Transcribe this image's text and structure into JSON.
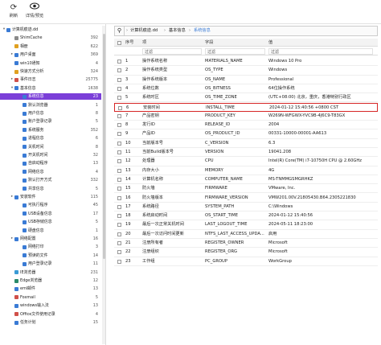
{
  "toolbar": {
    "refresh_label": "刷新",
    "view_label": "详情/预览"
  },
  "tree": [
    {
      "label": "计算机痕迹.dd",
      "count": "",
      "depth": 0,
      "expander": "▾",
      "color": "#3a7bd5"
    },
    {
      "label": "ShimCache",
      "count": "392",
      "depth": 1,
      "expander": "",
      "color": "#8a8a8a"
    },
    {
      "label": "相册",
      "count": "622",
      "depth": 1,
      "expander": "",
      "color": "#e0a020"
    },
    {
      "label": "用户桌面",
      "count": "369",
      "depth": 1,
      "expander": "▸",
      "color": "#3a7bd5"
    },
    {
      "label": "win10通知",
      "count": "4",
      "depth": 1,
      "expander": "",
      "color": "#3a7bd5"
    },
    {
      "label": "快速方式分析",
      "count": "324",
      "depth": 1,
      "expander": "",
      "color": "#e0a020"
    },
    {
      "label": "事件日志",
      "count": "25775",
      "depth": 1,
      "expander": "▸",
      "color": "#d0504a"
    },
    {
      "label": "基本信息",
      "count": "1638",
      "depth": 1,
      "expander": "▾",
      "color": "#3a7bd5"
    },
    {
      "label": "系统信息",
      "count": "23",
      "depth": 2,
      "expander": "",
      "color": "#3a7bd5",
      "selected": true
    },
    {
      "label": "默认浏览器",
      "count": "1",
      "depth": 2,
      "expander": "",
      "color": "#3a7bd5"
    },
    {
      "label": "用户信息",
      "count": "8",
      "depth": 2,
      "expander": "",
      "color": "#3a7bd5"
    },
    {
      "label": "账户登录记录",
      "count": "5",
      "depth": 2,
      "expander": "",
      "color": "#3a7bd5"
    },
    {
      "label": "系统服务",
      "count": "352",
      "depth": 2,
      "expander": "",
      "color": "#3a7bd5"
    },
    {
      "label": "进程信息",
      "count": "6",
      "depth": 2,
      "expander": "",
      "color": "#3a7bd5"
    },
    {
      "label": "关机时间",
      "count": "8",
      "depth": 2,
      "expander": "",
      "color": "#3a7bd5"
    },
    {
      "label": "开关机时间",
      "count": "32",
      "depth": 2,
      "expander": "",
      "color": "#3a7bd5"
    },
    {
      "label": "自启动程序",
      "count": "13",
      "depth": 2,
      "expander": "",
      "color": "#3a7bd5"
    },
    {
      "label": "网络信息",
      "count": "4",
      "depth": 2,
      "expander": "",
      "color": "#3a7bd5"
    },
    {
      "label": "默认打开方式",
      "count": "332",
      "depth": 2,
      "expander": "",
      "color": "#3a7bd5"
    },
    {
      "label": "共享信息",
      "count": "5",
      "depth": 2,
      "expander": "",
      "color": "#3a7bd5"
    },
    {
      "label": "安装软件",
      "count": "115",
      "depth": 1,
      "expander": "▸",
      "color": "#3a7bd5"
    },
    {
      "label": "可执行程序",
      "count": "45",
      "depth": 2,
      "expander": "",
      "color": "#3a7bd5"
    },
    {
      "label": "USB设备信息",
      "count": "17",
      "depth": 2,
      "expander": "",
      "color": "#3a7bd5"
    },
    {
      "label": "USB存储信息",
      "count": "5",
      "depth": 2,
      "expander": "",
      "color": "#3a7bd5"
    },
    {
      "label": "硬盘信息",
      "count": "1",
      "depth": 2,
      "expander": "",
      "color": "#3a7bd5"
    },
    {
      "label": "网络配置",
      "count": "16",
      "depth": 1,
      "expander": "▸",
      "color": "#3a7bd5"
    },
    {
      "label": "网络打印",
      "count": "3",
      "depth": 2,
      "expander": "",
      "color": "#3a7bd5"
    },
    {
      "label": "预读的文件",
      "count": "14",
      "depth": 2,
      "expander": "",
      "color": "#3a7bd5"
    },
    {
      "label": "用户登录记录",
      "count": "11",
      "depth": 2,
      "expander": "",
      "color": "#3a7bd5"
    },
    {
      "label": "IE浏览器",
      "count": "231",
      "depth": 1,
      "expander": "",
      "color": "#3a9bd5"
    },
    {
      "label": "Edge浏览器",
      "count": "12",
      "depth": 1,
      "expander": "",
      "color": "#2a8a6a"
    },
    {
      "label": "eml邮件",
      "count": "13",
      "depth": 1,
      "expander": "",
      "color": "#3a7bd5"
    },
    {
      "label": "Foxmail",
      "count": "5",
      "depth": 1,
      "expander": "",
      "color": "#d0504a"
    },
    {
      "label": "windows输入法",
      "count": "13",
      "depth": 1,
      "expander": "",
      "color": "#3a7bd5"
    },
    {
      "label": "Office文件使用记录",
      "count": "4",
      "depth": 1,
      "expander": "",
      "color": "#d0504a"
    },
    {
      "label": "任务计划",
      "count": "15",
      "depth": 1,
      "expander": "",
      "color": "#3a7bd5"
    }
  ],
  "breadcrumb": [
    "计算机痕迹.dd",
    "基本信息",
    "系统信息"
  ],
  "columns": {
    "index": "序号",
    "item": "项",
    "field": "字段",
    "value": "值"
  },
  "filter_placeholder": "过滤",
  "rows": [
    {
      "idx": "1",
      "item": "操作系统名称",
      "field": "MATERIALS_NAME",
      "value": "Windows 10 Pro"
    },
    {
      "idx": "2",
      "item": "操作系统类型",
      "field": "OS_TYPE",
      "value": "Windows"
    },
    {
      "idx": "3",
      "item": "操作系统版本",
      "field": "OS_NAME",
      "value": "Professional"
    },
    {
      "idx": "4",
      "item": "系统位数",
      "field": "OS_BITNESS",
      "value": "64位操作系统"
    },
    {
      "idx": "5",
      "item": "系统时区",
      "field": "OS_TIME_ZONE",
      "value": "(UTC+08:00) 北京，重庆，香港特别行政区"
    },
    {
      "idx": "6",
      "item": "安装时间",
      "field": "INSTALL_TIME",
      "value": "2024-01-12 15:40:56 +0800 CST",
      "highlight": true
    },
    {
      "idx": "7",
      "item": "产品密钥",
      "field": "PRODUCT_KEY",
      "value": "W269N-WFGWX-YVC9B-4J6C9-T83GX"
    },
    {
      "idx": "8",
      "item": "发行ID",
      "field": "RELEASE_ID",
      "value": "2004"
    },
    {
      "idx": "9",
      "item": "产品ID",
      "field": "OS_PRODUCT_ID",
      "value": "00331-10000-00001-AA613"
    },
    {
      "idx": "10",
      "item": "当前版本号",
      "field": "C_VERSION",
      "value": "6.3"
    },
    {
      "idx": "11",
      "item": "当前Build版本号",
      "field": "VERSION",
      "value": "19041.208"
    },
    {
      "idx": "12",
      "item": "处理器",
      "field": "CPU",
      "value": "Intel(R) Core(TM) i7-10750H CPU @ 2.60GHz"
    },
    {
      "idx": "13",
      "item": "内存大小",
      "field": "MEMORY",
      "value": "4G"
    },
    {
      "idx": "14",
      "item": "计算机名称",
      "field": "COMPUTER_NAME",
      "value": "MS-TNMMGSMGRHKZ"
    },
    {
      "idx": "15",
      "item": "防火墙",
      "field": "FIRMWARE",
      "value": "VMware, Inc."
    },
    {
      "idx": "16",
      "item": "防火墙版本",
      "field": "FIRMWARE_VERSION",
      "value": "VMW201.00V.21805430.B64.2305221830"
    },
    {
      "idx": "17",
      "item": "系统路径",
      "field": "SYSTEM_PATH",
      "value": "C:\\Windows"
    },
    {
      "idx": "18",
      "item": "系统启动时间",
      "field": "OS_START_TIME",
      "value": "2024-01-12 15:40:56"
    },
    {
      "idx": "19",
      "item": "最后一次正常关机时间",
      "field": "LAST_LOGOUT_TIME",
      "value": "2024-05-11 18:23:00"
    },
    {
      "idx": "20",
      "item": "最后一次访问时间更新",
      "field": "NTFS_LAST_ACCESS_UPDA...",
      "value": "启用"
    },
    {
      "idx": "21",
      "item": "注册所有者",
      "field": "REGISTER_OWNER",
      "value": "Microsoft"
    },
    {
      "idx": "22",
      "item": "注册组织",
      "field": "REGISTER_ORG",
      "value": "Microsoft"
    },
    {
      "idx": "23",
      "item": "工作组",
      "field": "PC_GROUP",
      "value": "WorkGroup"
    }
  ]
}
